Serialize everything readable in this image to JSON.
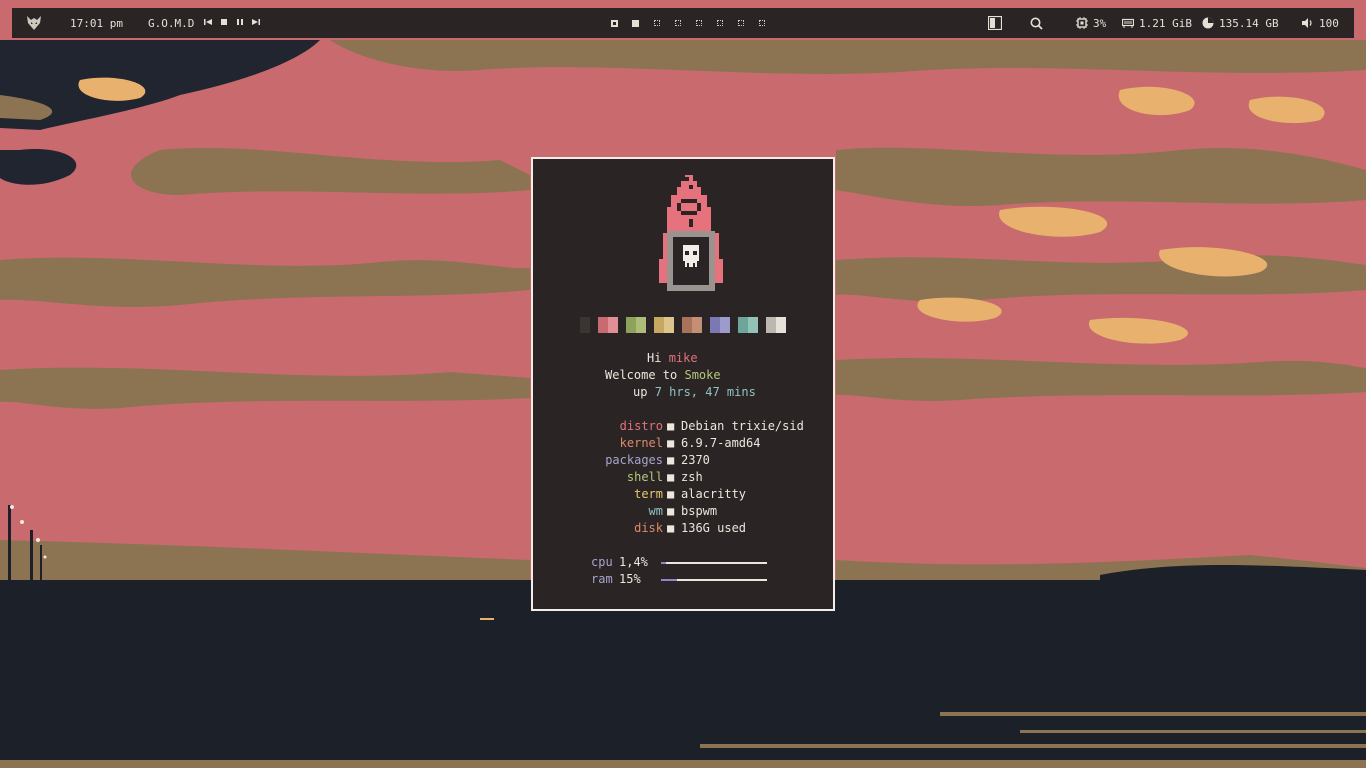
{
  "topbar": {
    "clock": "17:01 pm",
    "music_title": "G.O.M.D",
    "music_controls": [
      "previous-icon",
      "stop-icon",
      "pause-icon",
      "next-icon"
    ],
    "workspaces": [
      {
        "state": "occupied"
      },
      {
        "state": "focused"
      },
      {
        "state": "empty"
      },
      {
        "state": "empty"
      },
      {
        "state": "empty"
      },
      {
        "state": "empty"
      },
      {
        "state": "empty"
      },
      {
        "state": "empty"
      }
    ],
    "cpu": "3%",
    "ram": "1.21 GiB",
    "disk": "135.14 GB",
    "volume": "100"
  },
  "fetch": {
    "greeting_prefix": "Hi",
    "user": "mike",
    "welcome_prefix": "Welcome to",
    "host": "Smoke",
    "uptime_prefix": "up",
    "uptime": "7 hrs, 47 mins",
    "separator": "■",
    "rows": [
      {
        "label": "distro",
        "value": "Debian trixie/sid",
        "color": "#e2727a"
      },
      {
        "label": "kernel",
        "value": "6.9.7-amd64",
        "color": "#e0876a"
      },
      {
        "label": "packages",
        "value": "2370",
        "color": "#a9a2ce"
      },
      {
        "label": "shell",
        "value": "zsh",
        "color": "#b6c77a"
      },
      {
        "label": "term",
        "value": "alacritty",
        "color": "#e8c96f"
      },
      {
        "label": "wm",
        "value": "bspwm",
        "color": "#8fc3c2"
      },
      {
        "label": "disk",
        "value": "136G used",
        "color": "#e0876a"
      }
    ],
    "cpu_label": "cpu",
    "cpu_value": "1,4%",
    "cpu_fraction": 0.014,
    "ram_label": "ram",
    "ram_value": "15%",
    "ram_fraction": 0.15,
    "palette": [
      [
        "#2a2524",
        "#3a3433"
      ],
      [
        "#c96a73",
        "#e18f97"
      ],
      [
        "#8da35a",
        "#aebc7a"
      ],
      [
        "#c7a762",
        "#ddc48a"
      ],
      [
        "#a8735a",
        "#c48f74"
      ],
      [
        "#7b78b4",
        "#9d9bcc"
      ],
      [
        "#6ea59b",
        "#93c2b9"
      ],
      [
        "#bdb7b0",
        "#e6e1da"
      ]
    ]
  },
  "colors": {
    "bar_bg": "#2a2524",
    "accent_pink": "#e2727a",
    "wallpaper_pink": "#c96a6e",
    "wallpaper_navy": "#1c2029"
  }
}
